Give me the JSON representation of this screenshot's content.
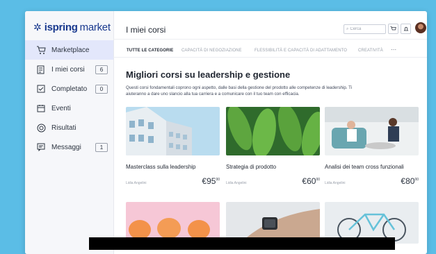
{
  "app": {
    "logo_part1": "ispring",
    "logo_part2": "market"
  },
  "sidebar": {
    "items": [
      {
        "label": "Marketplace",
        "icon": "cart-icon",
        "badge": ""
      },
      {
        "label": "I miei corsi",
        "icon": "courses-icon",
        "badge": "6"
      },
      {
        "label": "Completato",
        "icon": "checkbox-icon",
        "badge": "0"
      },
      {
        "label": "Eventi",
        "icon": "calendar-icon",
        "badge": ""
      },
      {
        "label": "Risultati",
        "icon": "results-icon",
        "badge": ""
      },
      {
        "label": "Messaggi",
        "icon": "message-icon",
        "badge": "1"
      }
    ]
  },
  "header": {
    "title": "I miei corsi",
    "search_placeholder": "Cerca"
  },
  "tabs": [
    "TUTTE LE CATEGORIE",
    "CAPACITÀ DI NEGOZIAZIONE",
    "FLESSIBILITÀ E CAPACITÀ DI ADATTAMENTO",
    "CREATIVITÀ",
    "···"
  ],
  "main": {
    "title": "Migliori corsi su leadership e gestione",
    "description": "Questi corsi fondamentali coprono ogni aspetto, dalle basi della gestione del prodotto alle competenze di leadership. Ti aiuteranno a dare uno slancio alla tua carriera e a comunicare con il tuo team con efficacia."
  },
  "courses": [
    {
      "name": "Masterclass sulla leadership",
      "author": "Lidia Angelini",
      "price": "€95",
      "price_sup": "00"
    },
    {
      "name": "Strategia di prodotto",
      "author": "Lidia Angelini",
      "price": "€60",
      "price_sup": "00"
    },
    {
      "name": "Analisi dei team cross funzionali",
      "author": "Lidia Angelini",
      "price": "€80",
      "price_sup": "00"
    }
  ]
}
